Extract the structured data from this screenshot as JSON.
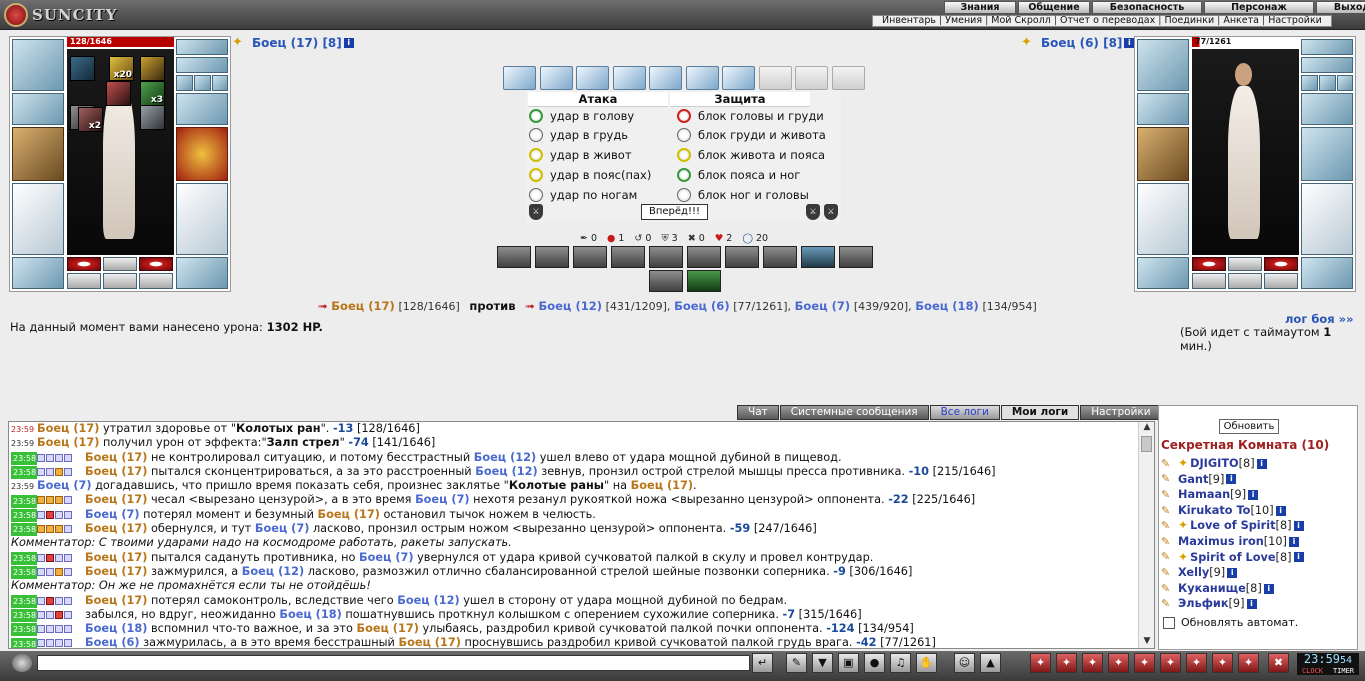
{
  "header": {
    "logo_text": "SUNCITY",
    "top_menu": [
      "Знания",
      "Общение",
      "Безопасность",
      "Персонаж",
      "Выход"
    ],
    "sub_menu": [
      "Инвентарь",
      "Умения",
      "Мой Скролл",
      "Отчет о переводах",
      "Поединки",
      "Анкета",
      "Настройки"
    ]
  },
  "left_fighter": {
    "hp": "128/1646",
    "title": "Боец (17) [8]",
    "buffs": [
      "",
      "x20",
      "",
      "",
      "x3",
      "",
      "x2",
      ""
    ]
  },
  "right_fighter": {
    "hp": "77/1261",
    "title": "Боец (6) [8]"
  },
  "combat": {
    "attack_header": "Атака",
    "defense_header": "Защита",
    "attacks": [
      "удар в голову",
      "удар в грудь",
      "удар в живот",
      "удар в пояс(пах)",
      "удар по ногам"
    ],
    "defenses": [
      "блок головы и груди",
      "блок груди и живота",
      "блок живота и пояса",
      "блок пояса и ног",
      "блок ног и головы"
    ],
    "go_button": "Вперёд!!!",
    "stats": [
      "0",
      "1",
      "0",
      "3",
      "0",
      "2",
      "20"
    ]
  },
  "versus": {
    "player_name": "Боец (17)",
    "player_hp": "[128/1646]",
    "against": "против",
    "enemies": [
      {
        "name": "Боец (12)",
        "hp": "[431/1209],"
      },
      {
        "name": "Боец (6)",
        "hp": "[77/1261],"
      },
      {
        "name": "Боец (7)",
        "hp": "[439/920],"
      },
      {
        "name": "Боец (18)",
        "hp": "[134/954]"
      }
    ]
  },
  "damage": {
    "prefix": "На данный момент вами нанесено урона:",
    "value": "1302 HP."
  },
  "battle_log_link": "лог боя »»",
  "timeout": {
    "prefix": "(Бой идет с таймаутом",
    "value": "1",
    "suffix": "мин.)"
  },
  "chat_tabs": [
    "Чат",
    "Системные сообщения",
    "Все логи",
    "Мои логи",
    "Настройки"
  ],
  "chat_lines": [
    {
      "t": "23:59",
      "tc": "red",
      "c": "",
      "p": [
        [
          "o",
          "Боец (17)"
        ],
        [
          "n",
          " утратил здоровье от \""
        ],
        [
          "b",
          "Колотых ран"
        ],
        [
          "n",
          "\". "
        ],
        [
          "v",
          "-13"
        ],
        [
          "n",
          " [128/1646]"
        ]
      ]
    },
    {
      "t": "23:59",
      "tc": "",
      "c": "",
      "p": [
        [
          "o",
          "Боец (17)"
        ],
        [
          "n",
          " получил урон от эффекта:\""
        ],
        [
          "b",
          "Залп стрел"
        ],
        [
          "n",
          "\" "
        ],
        [
          "v",
          "-74"
        ],
        [
          "n",
          " [141/1646]"
        ]
      ]
    },
    {
      "t": "23:58",
      "tc": "green",
      "c": "bbbb",
      "p": [
        [
          "o",
          "Боец (17)"
        ],
        [
          "n",
          " не контролировал ситуацию, и потому бесстрастный "
        ],
        [
          "bl",
          "Боец (12)"
        ],
        [
          "n",
          " ушел влево от удара мощной дубиной в пищевод."
        ]
      ]
    },
    {
      "t": "23:58",
      "tc": "green",
      "c": "bbob",
      "p": [
        [
          "o",
          "Боец (17)"
        ],
        [
          "n",
          " пытался сконцентрироваться, а за это расстроенный "
        ],
        [
          "bl",
          "Боец (12)"
        ],
        [
          "n",
          " зевнув, пронзил острой стрелой мышцы пресса противника. "
        ],
        [
          "v",
          "-10"
        ],
        [
          "n",
          " [215/1646]"
        ]
      ]
    },
    {
      "t": "23:59",
      "tc": "",
      "c": "",
      "p": [
        [
          "bl",
          "Боец (7)"
        ],
        [
          "n",
          " догадавшись, что пришло время показать себя, произнес заклятье \""
        ],
        [
          "b",
          "Колотые раны"
        ],
        [
          "n",
          "\" на "
        ],
        [
          "o",
          "Боец (17)"
        ],
        [
          "n",
          "."
        ]
      ]
    },
    {
      "t": "23:58",
      "tc": "green",
      "c": "ooob",
      "p": [
        [
          "o",
          "Боец (17)"
        ],
        [
          "n",
          " чесал <вырезано цензурой>, а в это время "
        ],
        [
          "bl",
          "Боец (7)"
        ],
        [
          "n",
          " нехотя резанул рукояткой ножа <вырезанно цензурой> оппонента. "
        ],
        [
          "v",
          "-22"
        ],
        [
          "n",
          " [225/1646]"
        ]
      ]
    },
    {
      "t": "23:58",
      "tc": "green",
      "c": "brbb",
      "p": [
        [
          "bl",
          "Боец (7)"
        ],
        [
          "n",
          " потерял момент и безумный "
        ],
        [
          "o",
          "Боец (17)"
        ],
        [
          "n",
          " остановил тычок ножем в челюсть."
        ]
      ]
    },
    {
      "t": "23:58",
      "tc": "green",
      "c": "ooob",
      "p": [
        [
          "o",
          "Боец (17)"
        ],
        [
          "n",
          " обернулся, и тут "
        ],
        [
          "bl",
          "Боец (7)"
        ],
        [
          "n",
          " ласково, пронзил острым ножом <вырезанно цензурой> оппонента. "
        ],
        [
          "v",
          "-59"
        ],
        [
          "n",
          " [247/1646]"
        ]
      ]
    },
    {
      "t": "",
      "tc": "",
      "c": "",
      "p": [
        [
          "i",
          "Комментатор: С твоими ударами надо на космодроме работать, ракеты запускать."
        ]
      ]
    },
    {
      "t": "23:58",
      "tc": "green",
      "c": "brbb",
      "p": [
        [
          "o",
          "Боец (17)"
        ],
        [
          "n",
          " пытался садануть противника, но "
        ],
        [
          "bl",
          "Боец (7)"
        ],
        [
          "n",
          " увернулся от удара кривой сучковатой палкой в скулу и провел контрудар."
        ]
      ]
    },
    {
      "t": "23:58",
      "tc": "green",
      "c": "bbob",
      "p": [
        [
          "o",
          "Боец (17)"
        ],
        [
          "n",
          " зажмурился, а "
        ],
        [
          "bl",
          "Боец (12)"
        ],
        [
          "n",
          " ласково, размозжил отлично сбалансированной стрелой шейные позвонки соперника. "
        ],
        [
          "v",
          "-9"
        ],
        [
          "n",
          " [306/1646]"
        ]
      ]
    },
    {
      "t": "",
      "tc": "",
      "c": "",
      "p": [
        [
          "i",
          "Комментатор: Он же не промахнётся если ты не отойдёшь!"
        ]
      ]
    },
    {
      "t": "23:58",
      "tc": "green",
      "c": "brbb",
      "p": [
        [
          "o",
          "Боец (17)"
        ],
        [
          "n",
          " потерял самоконтроль, вследствие чего "
        ],
        [
          "bl",
          "Боец (12)"
        ],
        [
          "n",
          " ушел в сторону от удара мощной дубиной по бедрам."
        ]
      ]
    },
    {
      "t": "23:58",
      "tc": "green",
      "c": "bbrb",
      "p": [
        [
          "n",
          "забылся, но вдруг, неожиданно "
        ],
        [
          "bl",
          "Боец (18)"
        ],
        [
          "n",
          " пошатнувшись проткнул колышком с оперением сухожилие соперника. "
        ],
        [
          "v",
          "-7"
        ],
        [
          "n",
          " [315/1646]"
        ]
      ]
    },
    {
      "t": "23:58",
      "tc": "green",
      "c": "bbbb",
      "p": [
        [
          "bl",
          "Боец (18)"
        ],
        [
          "n",
          " вспомнил что-то важное, и за это "
        ],
        [
          "o",
          "Боец (17)"
        ],
        [
          "n",
          " улыбаясь, раздробил кривой сучковатой палкой почки оппонента. "
        ],
        [
          "v",
          "-124"
        ],
        [
          "n",
          " [134/954]"
        ]
      ]
    },
    {
      "t": "23:58",
      "tc": "green",
      "c": "bbbb",
      "p": [
        [
          "bl",
          "Боец (6)"
        ],
        [
          "n",
          " зажмурилась, а в это время бесстрашный "
        ],
        [
          "o",
          "Боец (17)"
        ],
        [
          "n",
          " проснувшись раздробил кривой сучковатой палкой грудь врага. "
        ],
        [
          "v",
          "-42"
        ],
        [
          "n",
          " [77/1261]"
        ]
      ]
    }
  ],
  "room": {
    "refresh": "Обновить",
    "title": "Секретная Комната (10)",
    "players": [
      {
        "name": "DJIGITO",
        "lvl": "[8]"
      },
      {
        "name": "Gant",
        "lvl": "[9]"
      },
      {
        "name": "Hamaan",
        "lvl": "[9]"
      },
      {
        "name": "Kirukato To",
        "lvl": "[10]"
      },
      {
        "name": "Love of Spirit",
        "lvl": "[8]"
      },
      {
        "name": "Maximus iron",
        "lvl": "[10]"
      },
      {
        "name": "Spirit of Love",
        "lvl": "[8]"
      },
      {
        "name": "Xelly",
        "lvl": "[9]"
      },
      {
        "name": "Куканище",
        "lvl": "[8]"
      },
      {
        "name": "Эльфик",
        "lvl": "[9]"
      }
    ],
    "auto_refresh": "Обновлять автомат."
  },
  "clock": {
    "time": "23:59",
    "seconds": "54",
    "labels": [
      "CLOCK",
      "TIMER"
    ]
  }
}
